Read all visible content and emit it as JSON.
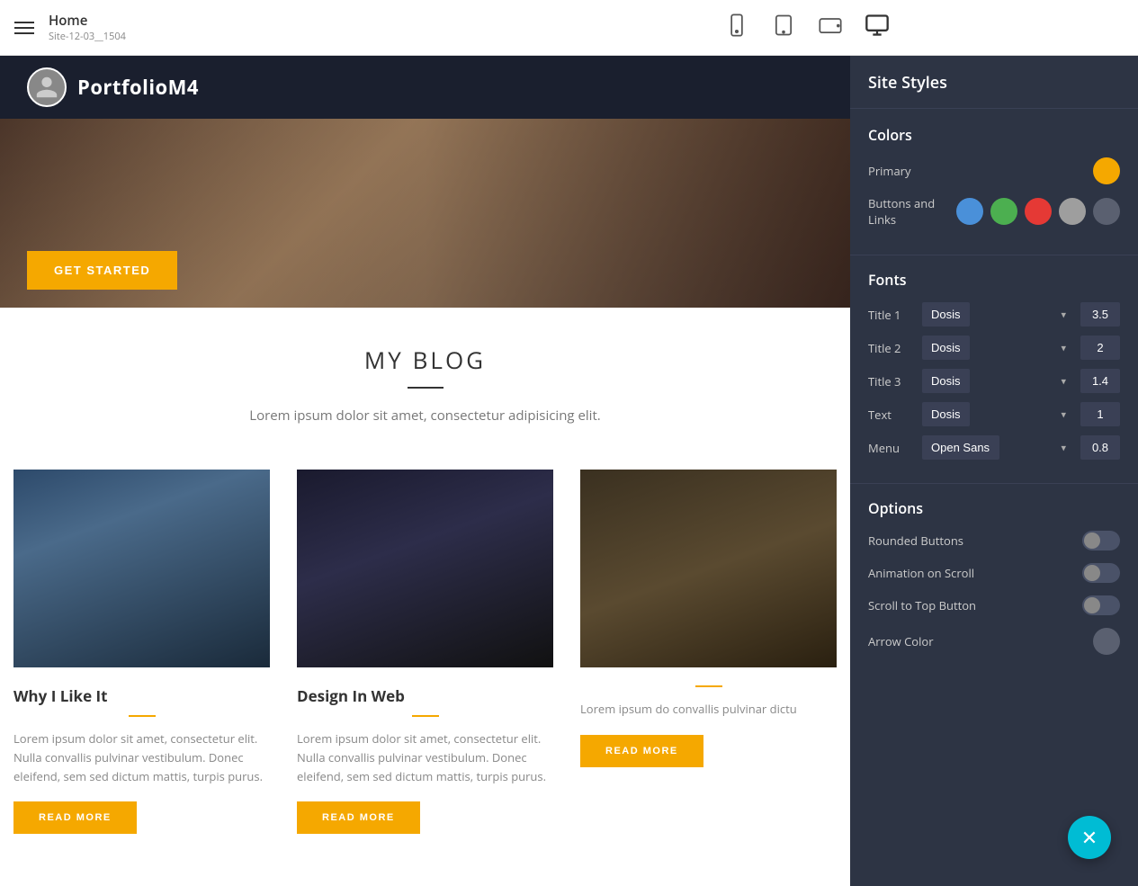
{
  "topbar": {
    "hamburger_label": "menu",
    "page_title": "Home",
    "page_subtitle": "Site-12-03__1504",
    "devices": [
      "mobile",
      "tablet",
      "tablet-landscape",
      "desktop"
    ]
  },
  "sidebar": {
    "title": "Site Styles",
    "colors": {
      "section_title": "Colors",
      "primary_label": "Primary",
      "primary_color": "#f5a800",
      "buttons_links_label": "Buttons and Links",
      "swatches": [
        "blue",
        "green",
        "red",
        "gray",
        "darkgray"
      ]
    },
    "fonts": {
      "section_title": "Fonts",
      "rows": [
        {
          "label": "Title 1",
          "font": "Dosis",
          "size": "3.5"
        },
        {
          "label": "Title 2",
          "font": "Dosis",
          "size": "2"
        },
        {
          "label": "Title 3",
          "font": "Dosis",
          "size": "1.4"
        },
        {
          "label": "Text",
          "font": "Dosis",
          "size": "1"
        },
        {
          "label": "Menu",
          "font": "Open Sans",
          "size": "0.8"
        }
      ]
    },
    "options": {
      "section_title": "Options",
      "rounded_buttons_label": "Rounded Buttons",
      "rounded_buttons_on": false,
      "animation_scroll_label": "Animation on Scroll",
      "animation_scroll_on": false,
      "scroll_top_label": "Scroll to Top Button",
      "scroll_top_on": false,
      "arrow_color_label": "Arrow Color"
    }
  },
  "preview": {
    "logo_text": "PortfolioM4",
    "get_started_label": "GET STARTED",
    "blog_title": "MY BLOG",
    "blog_subtitle": "Lorem ipsum dolor sit amet, consectetur adipisicing elit.",
    "cards": [
      {
        "title": "Why I Like It",
        "text": "Lorem ipsum dolor sit amet, consectetur elit. Nulla convallis pulvinar vestibulum. Donec eleifend, sem sed dictum mattis, turpis purus.",
        "read_more": "READ MORE"
      },
      {
        "title": "Design In Web",
        "text": "Lorem ipsum dolor sit amet, consectetur elit. Nulla convallis pulvinar vestibulum. Donec eleifend, sem sed dictum mattis, turpis purus.",
        "read_more": "READ MORE"
      },
      {
        "title": "",
        "text": "Lorem ipsum do convallis pulvinar dictu",
        "read_more": "READ MORE"
      }
    ]
  },
  "fab": {
    "icon": "×",
    "label": "close-fab"
  }
}
